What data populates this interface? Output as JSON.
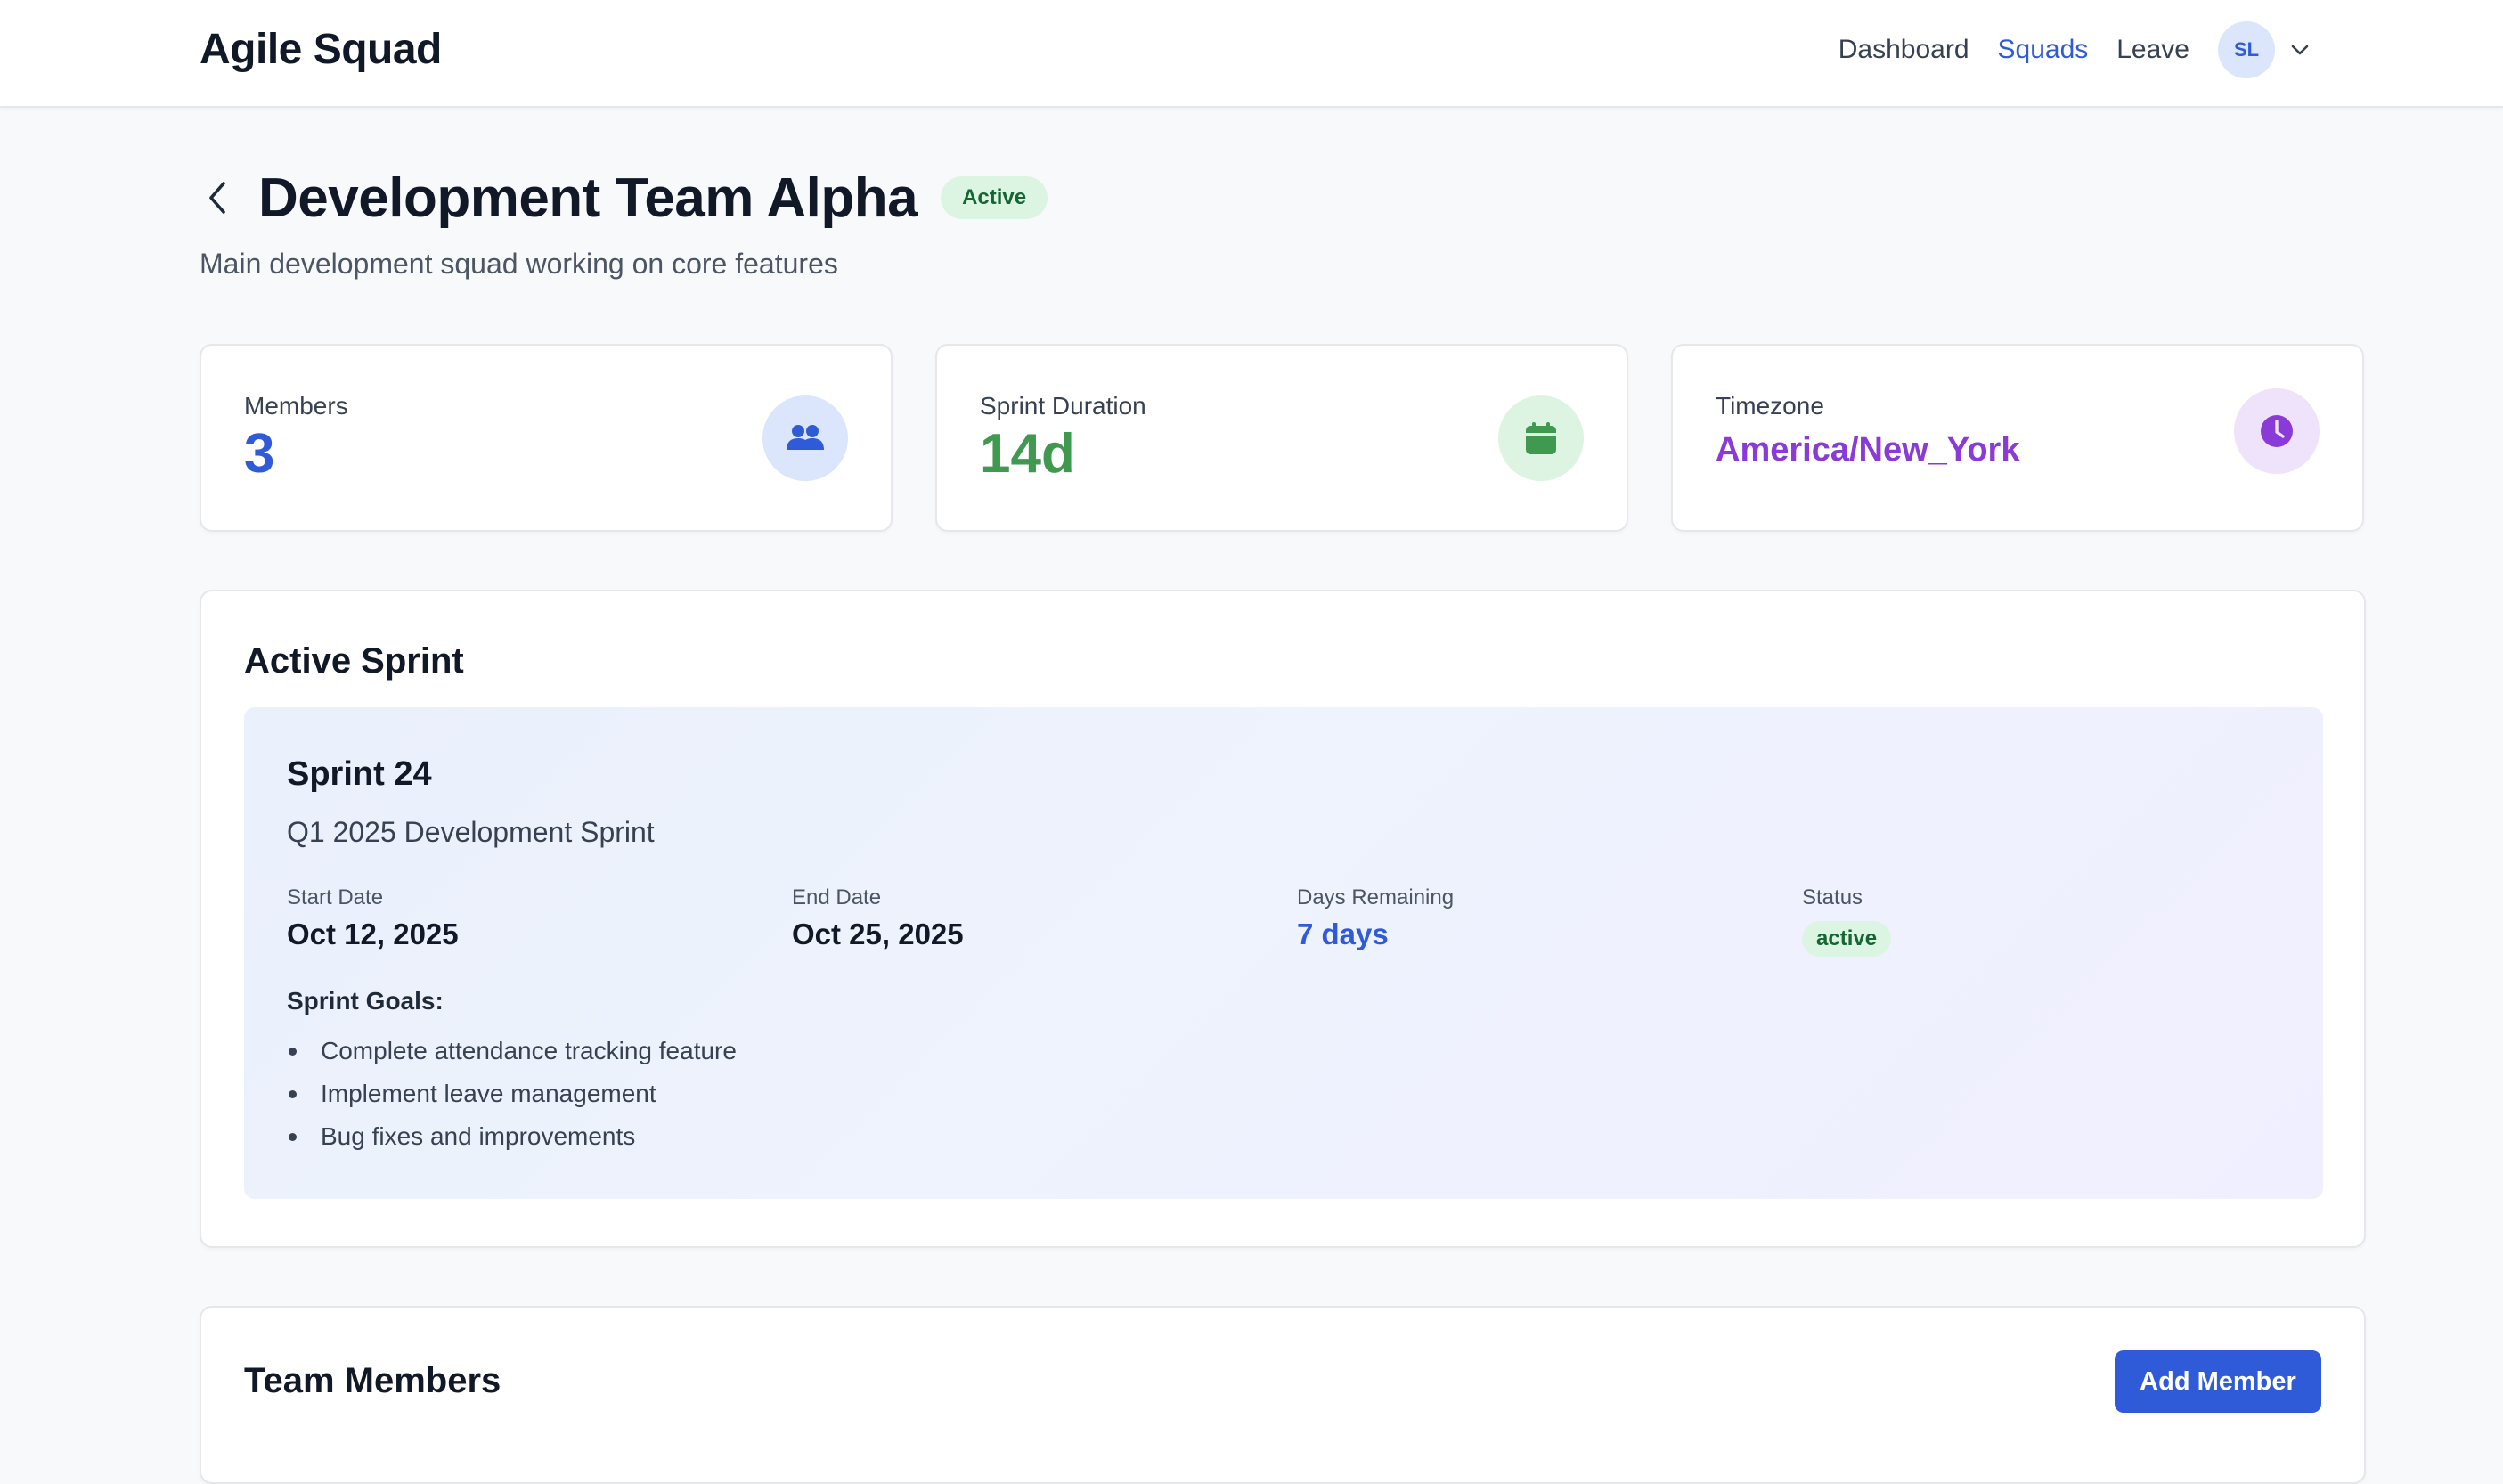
{
  "app": {
    "brand": "Agile Squad"
  },
  "nav": {
    "links": [
      "Dashboard",
      "Squads",
      "Leave"
    ],
    "active": "Squads",
    "avatar_initials": "SL"
  },
  "page": {
    "title": "Development Team Alpha",
    "status_badge": "Active",
    "subtitle": "Main development squad working on core features"
  },
  "stats": [
    {
      "label": "Members",
      "value": "3",
      "color": "#2f5bd8",
      "icon": "users-icon",
      "icon_bg": "#dbe5fb"
    },
    {
      "label": "Sprint Duration",
      "value": "14d",
      "color": "#3f9a4f",
      "icon": "calendar-icon",
      "icon_bg": "#ddf4e2"
    },
    {
      "label": "Timezone",
      "value": "America/New_York",
      "color": "#8a3ad6",
      "icon": "clock-icon",
      "icon_bg": "#efe3fb"
    }
  ],
  "active_sprint": {
    "heading": "Active Sprint",
    "name": "Sprint 24",
    "description": "Q1 2025 Development Sprint",
    "start_label": "Start Date",
    "start_value": "Oct 12, 2025",
    "end_label": "End Date",
    "end_value": "Oct 25, 2025",
    "remaining_label": "Days Remaining",
    "remaining_value": "7 days",
    "status_label": "Status",
    "status_value": "active",
    "goals_title": "Sprint Goals:",
    "goals": [
      "Complete attendance tracking feature",
      "Implement leave management",
      "Bug fixes and improvements"
    ]
  },
  "team_members": {
    "heading": "Team Members",
    "add_button": "Add Member"
  }
}
